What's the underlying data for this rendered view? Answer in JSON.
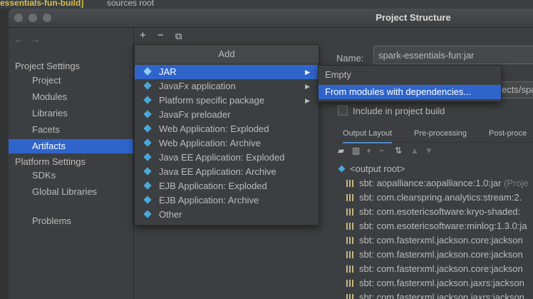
{
  "background": {
    "file_tab": "essentials-fun-build]",
    "sources_root": "sources root"
  },
  "dialog": {
    "title": "Project Structure"
  },
  "toolbar": {
    "add": "+",
    "remove": "−",
    "copy": "⧉"
  },
  "sidebar": {
    "project_settings_header": "Project Settings",
    "project_settings_items": [
      "Project",
      "Modules",
      "Libraries",
      "Facets",
      "Artifacts"
    ],
    "platform_settings_header": "Platform Settings",
    "platform_settings_items": [
      "SDKs",
      "Global Libraries"
    ],
    "problems": "Problems",
    "selected": "Artifacts"
  },
  "add_menu": {
    "title": "Add",
    "items": [
      {
        "label": "JAR",
        "submenu": true,
        "selected": true
      },
      {
        "label": "JavaFx application",
        "submenu": true
      },
      {
        "label": "Platform specific package",
        "submenu": true
      },
      {
        "label": "JavaFx preloader"
      },
      {
        "label": "Web Application: Exploded"
      },
      {
        "label": "Web Application: Archive"
      },
      {
        "label": "Java EE Application: Exploded"
      },
      {
        "label": "Java EE Application: Archive"
      },
      {
        "label": "EJB Application: Exploded"
      },
      {
        "label": "EJB Application: Archive"
      },
      {
        "label": "Other"
      }
    ]
  },
  "jar_submenu": {
    "items": [
      "Empty",
      "From modules with dependencies..."
    ],
    "selected": "From modules with dependencies..."
  },
  "artifact": {
    "name_label": "Name:",
    "name_value": "spark-essentials-fun:jar",
    "output_directory_partial": "ects/spa",
    "include_in_build": "Include in project build",
    "tabs": [
      "Output Layout",
      "Pre-processing",
      "Post-proce"
    ],
    "active_tab": "Output Layout",
    "output_root": "<output root>",
    "libraries": [
      {
        "name": "sbt: aopalliance:aopalliance:1.0:jar",
        "suffix": " (Proje"
      },
      {
        "name": "sbt: com.clearspring.analytics:stream:2."
      },
      {
        "name": "sbt: com.esotericsoftware:kryo-shaded:"
      },
      {
        "name": "sbt: com.esotericsoftware:minlog:1.3.0:ja"
      },
      {
        "name": "sbt: com.fasterxml.jackson.core:jackson"
      },
      {
        "name": "sbt: com.fasterxml.jackson.core:jackson"
      },
      {
        "name": "sbt: com.fasterxml.jackson.core:jackson"
      },
      {
        "name": "sbt: com.fasterxml.jackson.jaxrs:jackson"
      },
      {
        "name": "sbt: com.fasterxml.jackson.jaxrs:jackson"
      }
    ]
  }
}
